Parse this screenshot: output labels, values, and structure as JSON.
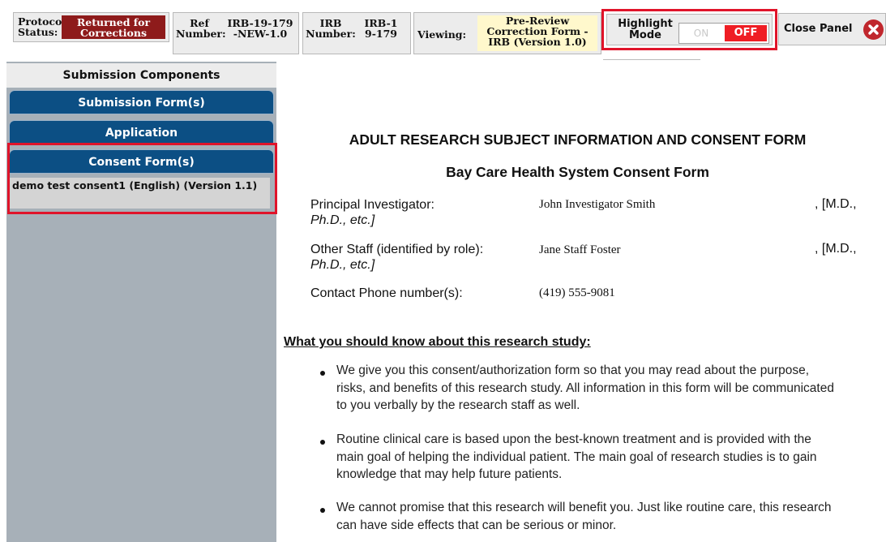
{
  "header": {
    "protocol_status_label": "Protocol Status:",
    "protocol_status_value": "Returned for Corrections",
    "ref_number_label": "Ref Number:",
    "ref_number_value": "IRB-19-179-NEW-1.0",
    "irb_number_label": "IRB Number:",
    "irb_number_value": "IRB-19-179",
    "viewing_label": "Viewing:",
    "viewing_value": "Pre-Review Correction Form - IRB (Version 1.0)",
    "highlight_mode_label": "Highlight Mode",
    "toggle_on_label": "ON",
    "toggle_off_label": "OFF",
    "close_panel_label": "Close Panel",
    "close_icon": "close-circle-icon"
  },
  "sidebar": {
    "title": "Submission Components",
    "buttons": [
      "Submission Form(s)",
      "Application",
      "Consent Form(s)"
    ],
    "consent_item": "demo test consent1 (English) (Version 1.1)"
  },
  "document": {
    "title": "ADULT RESEARCH SUBJECT INFORMATION AND CONSENT FORM",
    "subtitle": "Bay Care Health System Consent Form",
    "rows": [
      {
        "label": "Principal Investigator:",
        "label_cont": "Ph.D., etc.]",
        "value": "John Investigator Smith",
        "suffix": ", [M.D.,"
      },
      {
        "label": "Other Staff (identified by role):",
        "label_cont": "Ph.D., etc.]",
        "value": "Jane Staff Foster",
        "suffix": ", [M.D.,"
      },
      {
        "label": "Contact Phone number(s):",
        "value": "(419) 555-9081"
      }
    ],
    "section_heading": "What you should know about this research study:",
    "bullets": [
      "We give you this consent/authorization form so that you may read about the purpose, risks, and benefits of this research study. All information in this form will be communicated to you verbally by the research staff as well.",
      "Routine clinical care is based upon the best-known treatment and is provided with the main goal of helping the individual patient.  The main goal of research studies is to gain knowledge that may help future patients.",
      "We cannot promise that this research will benefit you.  Just like routine care, this research can have side effects that can be serious or minor."
    ]
  },
  "colors": {
    "status_bg": "#8e1b1b",
    "nav_button": "#0c4f84",
    "sidebar_bg": "#a7b0b8",
    "highlight_border": "#e0142a",
    "toggle_off_bg": "#ef1d24",
    "viewing_bg": "#fff8cc"
  }
}
